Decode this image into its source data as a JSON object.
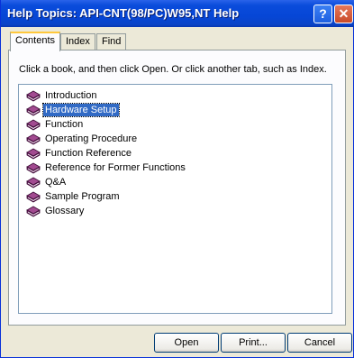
{
  "window": {
    "title": "Help Topics: API-CNT(98/PC)W95,NT Help",
    "help_glyph": "?",
    "close_glyph": "✕"
  },
  "tabs": [
    {
      "label": "Contents"
    },
    {
      "label": "Index"
    },
    {
      "label": "Find"
    }
  ],
  "instruction": "Click a book, and then click Open. Or click another tab, such as Index.",
  "topics": [
    {
      "label": "Introduction",
      "icon": "book-icon"
    },
    {
      "label": "Hardware Setup",
      "icon": "book-icon",
      "selected": true
    },
    {
      "label": "Function",
      "icon": "book-icon"
    },
    {
      "label": "Operating Procedure",
      "icon": "book-icon"
    },
    {
      "label": "Function Reference",
      "icon": "book-icon"
    },
    {
      "label": "Reference for Former Functions",
      "icon": "book-icon"
    },
    {
      "label": "Q&A",
      "icon": "book-icon"
    },
    {
      "label": "Sample Program",
      "icon": "book-icon"
    },
    {
      "label": "Glossary",
      "icon": "book-icon"
    }
  ],
  "buttons": {
    "open": "Open",
    "print": "Print...",
    "cancel": "Cancel"
  },
  "colors": {
    "titlebar": "#0A4CDB",
    "selection": "#316AC5",
    "book": "#7B2D6E"
  }
}
